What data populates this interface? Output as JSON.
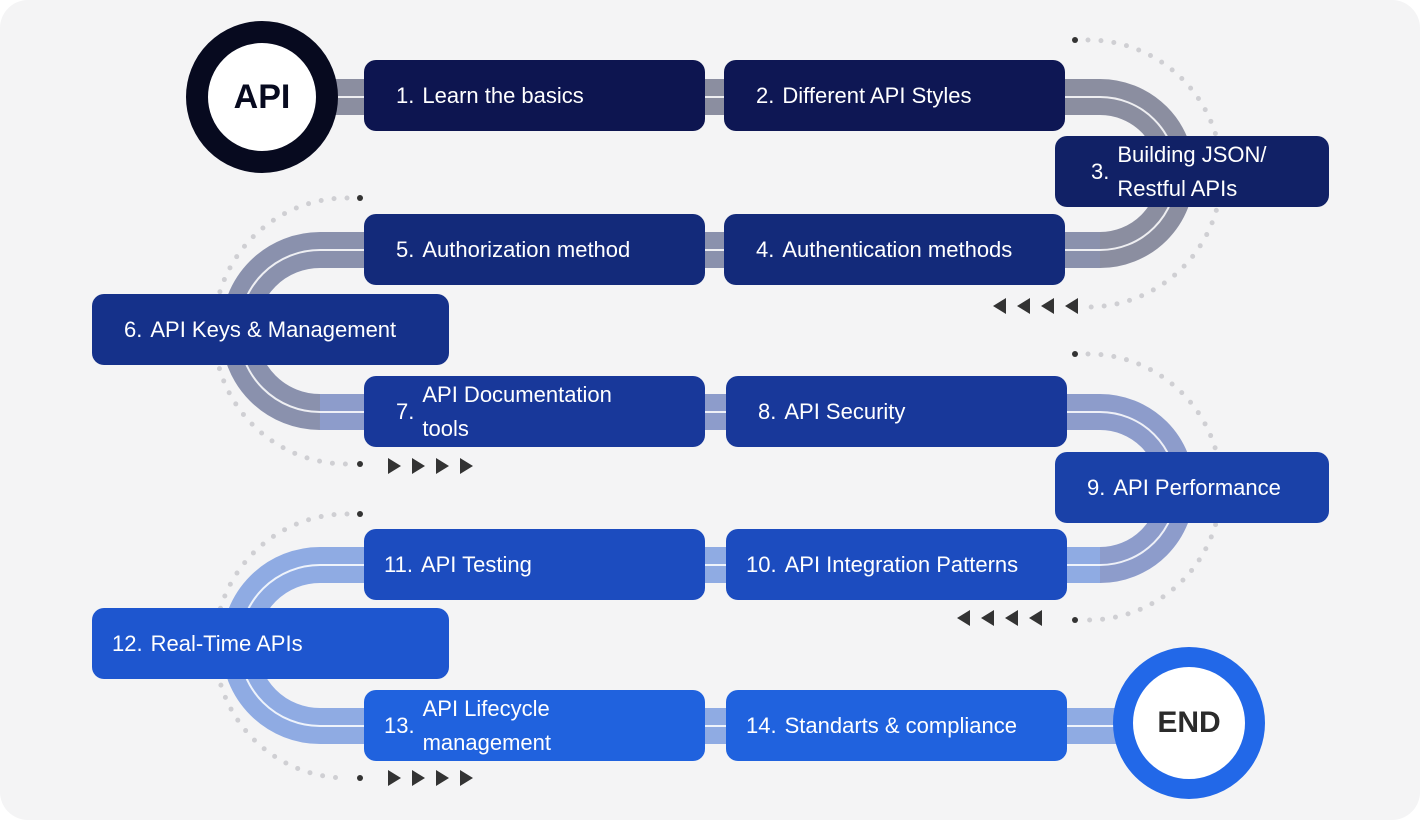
{
  "start": {
    "label": "API",
    "ring_color": "#070a1f"
  },
  "end": {
    "label": "END",
    "ring_color": "#2268e8"
  },
  "steps": [
    {
      "num": "1.",
      "label": "Learn the basics",
      "color": "#0d1550"
    },
    {
      "num": "2.",
      "label": "Different API Styles",
      "color": "#0e1754"
    },
    {
      "num": "3.",
      "label": "Building JSON/ Restful APIs",
      "color": "#112166"
    },
    {
      "num": "4.",
      "label": "Authentication methods",
      "color": "#132a7a"
    },
    {
      "num": "5.",
      "label": "Authorization method",
      "color": "#132a7a"
    },
    {
      "num": "6.",
      "label": "API Keys & Management",
      "color": "#15318a"
    },
    {
      "num": "7.",
      "label": "API Documentation tools",
      "color": "#18389a"
    },
    {
      "num": "8.",
      "label": "API Security",
      "color": "#18389a"
    },
    {
      "num": "9.",
      "label": "API Performance",
      "color": "#1a41a8"
    },
    {
      "num": "10.",
      "label": "API Integration Patterns",
      "color": "#1c4cbf"
    },
    {
      "num": "11.",
      "label": "API Testing",
      "color": "#1c4cbf"
    },
    {
      "num": "12.",
      "label": "Real-Time APIs",
      "color": "#1e56cf"
    },
    {
      "num": "13.",
      "label": "API Lifecycle management",
      "color": "#2062de"
    },
    {
      "num": "14.",
      "label": "Standarts & compliance",
      "color": "#2062de"
    }
  ],
  "icons": {
    "direction_arrow": "triangle-arrow-icon"
  }
}
